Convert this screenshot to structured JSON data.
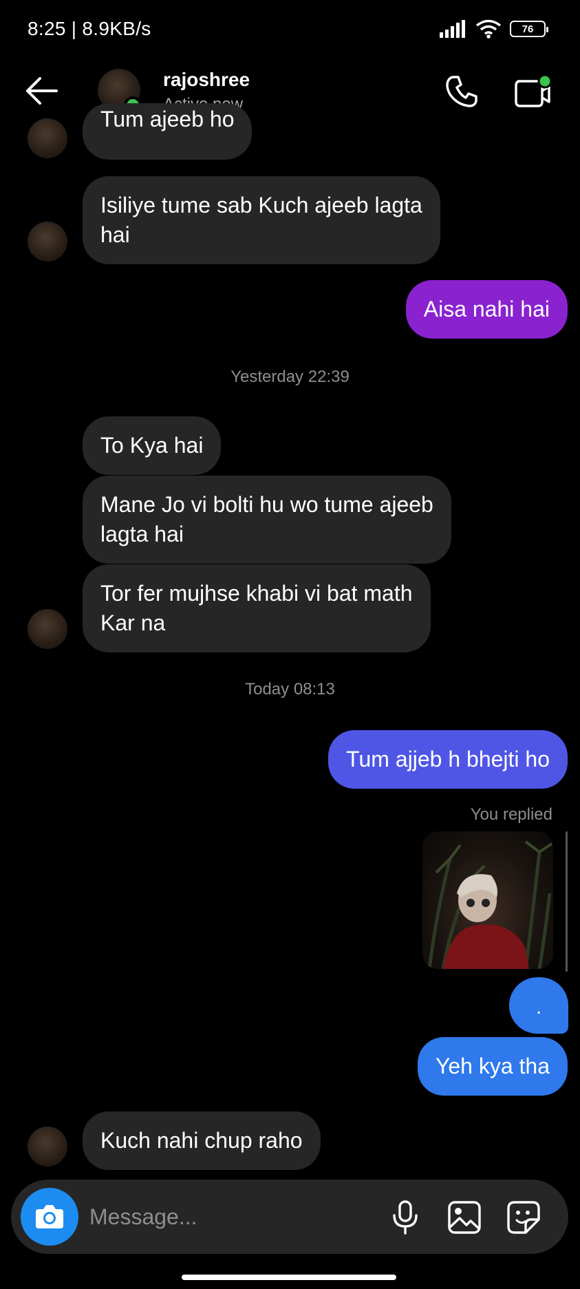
{
  "status_bar": {
    "time": "8:25 | 8.9KB/s",
    "battery": "76"
  },
  "header": {
    "name": "rajoshree",
    "status": "Active now"
  },
  "messages": [
    {
      "text": "Tum ajeeb ho"
    },
    {
      "text": "Isiliye tume sab Kuch ajeeb lagta\nhai"
    },
    {
      "text": "Aisa nahi hai"
    },
    {
      "text": "Yesterday 22:39"
    },
    {
      "text": "To Kya hai"
    },
    {
      "text": "Mane Jo vi bolti hu wo tume ajeeb\nlagta hai"
    },
    {
      "text": "Tor fer mujhse khabi vi bat math\nKar na"
    },
    {
      "text": "Today 08:13"
    },
    {
      "text": "Tum ajjeb h bhejti ho"
    },
    {
      "text": "You replied"
    },
    {
      "text": "."
    },
    {
      "text": "Yeh kya tha"
    },
    {
      "text": "Kuch nahi chup raho"
    }
  ],
  "composer": {
    "placeholder": "Message..."
  },
  "colors": {
    "incoming": "#262626",
    "outgoing_purple": "#8a22d0",
    "outgoing_indigo": "#4f56e6",
    "outgoing_blue": "#2f79ec",
    "online": "#3ac44e",
    "camera": "#1d8cf0"
  },
  "icons": [
    "back-arrow-icon",
    "phone-icon",
    "video-icon",
    "camera-icon",
    "microphone-icon",
    "image-icon",
    "sticker-icon"
  ]
}
